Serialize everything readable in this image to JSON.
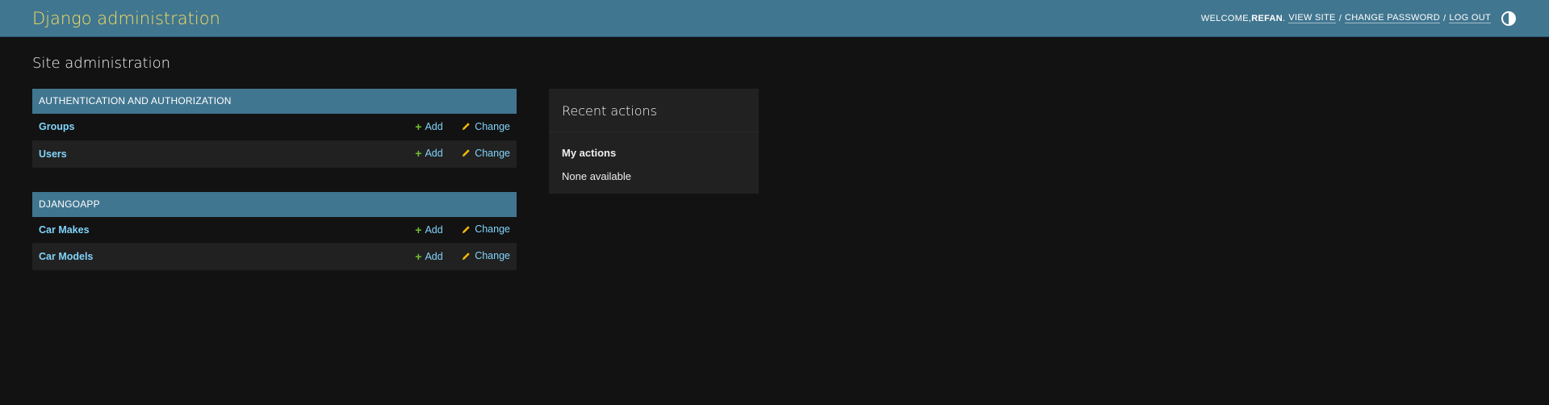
{
  "header": {
    "site_name": "Django administration",
    "welcome_text": "Welcome, ",
    "username": "Refan",
    "username_suffix": ".",
    "view_site": "View site",
    "change_password": "Change password",
    "log_out": "Log out",
    "separator": "/",
    "theme_toggle_icon": "contrast-icon"
  },
  "page": {
    "title": "Site administration"
  },
  "apps": [
    {
      "name": "Authentication and Authorization",
      "models": [
        {
          "name": "Groups",
          "add": "Add",
          "change": "Change"
        },
        {
          "name": "Users",
          "add": "Add",
          "change": "Change"
        }
      ]
    },
    {
      "name": "Djangoapp",
      "models": [
        {
          "name": "Car Makes",
          "add": "Add",
          "change": "Change"
        },
        {
          "name": "Car Models",
          "add": "Add",
          "change": "Change"
        }
      ]
    }
  ],
  "recent_actions": {
    "title": "Recent actions",
    "subtitle": "My actions",
    "empty_text": "None available"
  },
  "colors": {
    "header_bg": "#417690",
    "brand": "#f5dd5d",
    "link": "#81d4fa",
    "add_icon": "#70bf2b",
    "change_icon": "#efb80b",
    "background": "#121212"
  },
  "icons": {
    "add": "plus-icon",
    "change": "pencil-icon"
  }
}
